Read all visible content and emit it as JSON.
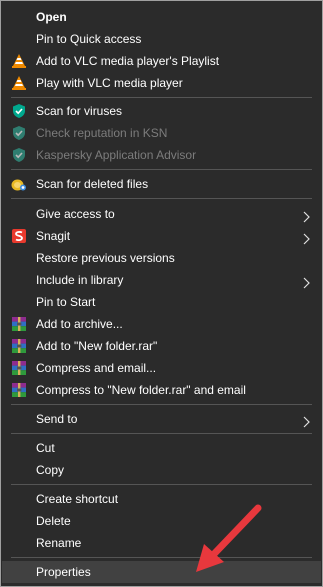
{
  "context_menu": {
    "open": "Open",
    "pin_quick_access": "Pin to Quick access",
    "vlc_playlist": "Add to VLC media player's Playlist",
    "vlc_play": "Play with VLC media player",
    "scan_viruses": "Scan for viruses",
    "check_reputation": "Check reputation in KSN",
    "kaspersky_advisor": "Kaspersky Application Advisor",
    "scan_deleted": "Scan for deleted files",
    "give_access": "Give access to",
    "snagit": "Snagit",
    "restore_versions": "Restore previous versions",
    "include_library": "Include in library",
    "pin_start": "Pin to Start",
    "add_archive": "Add to archive...",
    "add_named_rar": "Add to \"New folder.rar\"",
    "compress_email": "Compress and email...",
    "compress_named_email": "Compress to \"New folder.rar\" and email",
    "send_to": "Send to",
    "cut": "Cut",
    "copy": "Copy",
    "create_shortcut": "Create shortcut",
    "delete": "Delete",
    "rename": "Rename",
    "properties": "Properties"
  },
  "icons": {
    "vlc": "vlc-cone-icon",
    "kaspersky": "kaspersky-shield-icon",
    "recovery": "file-recovery-icon",
    "snagit": "snagit-icon",
    "winrar": "winrar-icon",
    "submenu": "chevron-right-icon",
    "annotation": "red-arrow-icon"
  },
  "colors": {
    "menu_bg": "#2b2b2b",
    "text": "#ffffff",
    "disabled_text": "#7c7c7c",
    "highlight": "#414141",
    "arrow": "#e8383d"
  }
}
